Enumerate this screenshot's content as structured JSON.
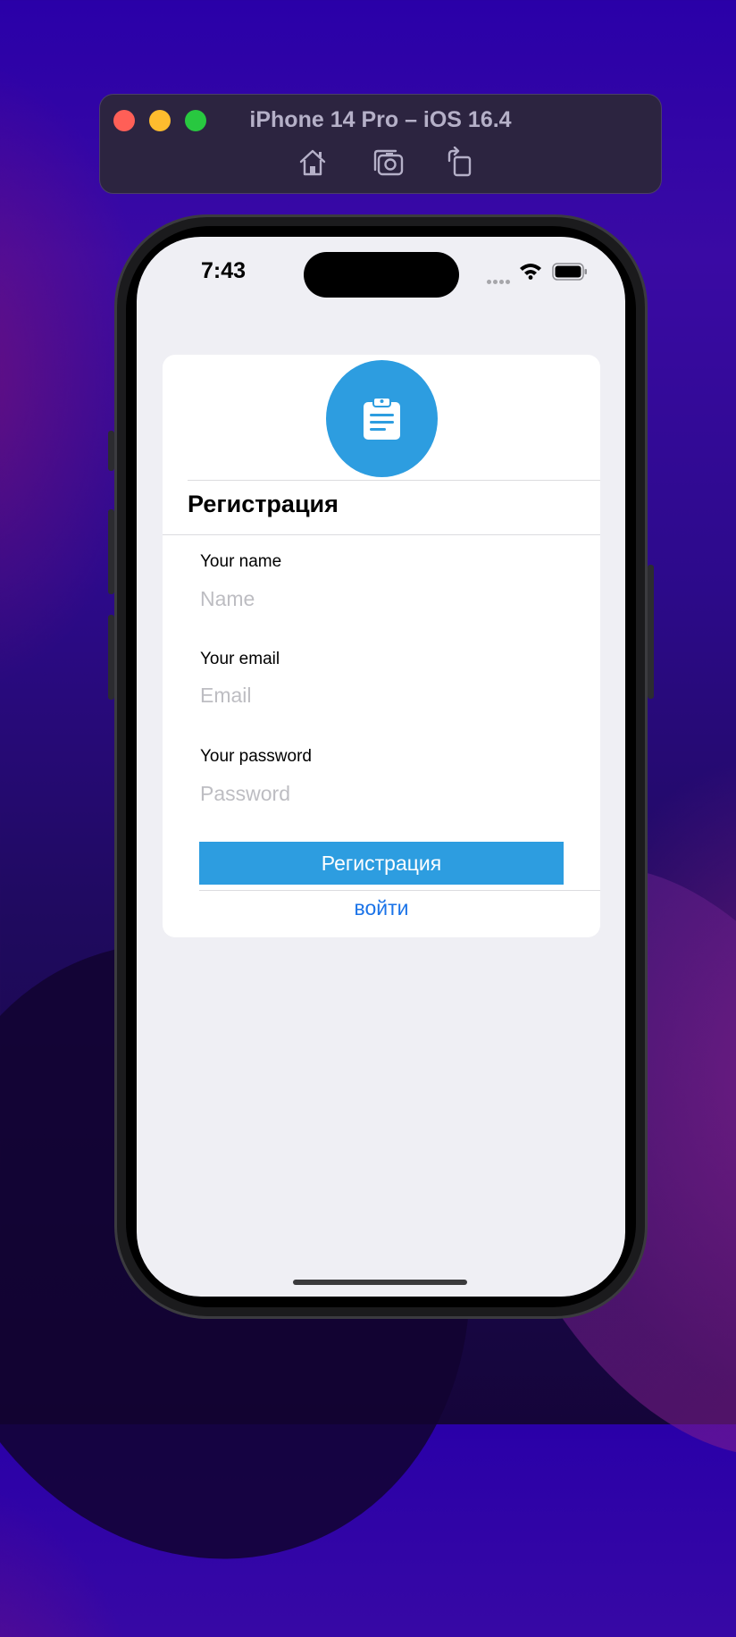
{
  "simulator": {
    "title": "iPhone 14 Pro – iOS 16.4",
    "tools": [
      {
        "icon": "home-icon"
      },
      {
        "icon": "screenshot-camera-icon"
      },
      {
        "icon": "rotate-icon"
      }
    ]
  },
  "status_bar": {
    "time": "7:43",
    "icons": [
      "cellular-signal-icon",
      "wifi-icon",
      "battery-icon"
    ]
  },
  "card": {
    "avatar_icon": "clipboard-icon",
    "accent_color": "#2d9de0",
    "title": "Регистрация",
    "fields": [
      {
        "label": "Your name",
        "placeholder": "Name",
        "value": ""
      },
      {
        "label": "Your email",
        "placeholder": "Email",
        "value": ""
      },
      {
        "label": "Your password",
        "placeholder": "Password",
        "value": ""
      }
    ],
    "register_button": "Регистрация",
    "login_link": "войти",
    "link_color": "#1a73e8"
  }
}
